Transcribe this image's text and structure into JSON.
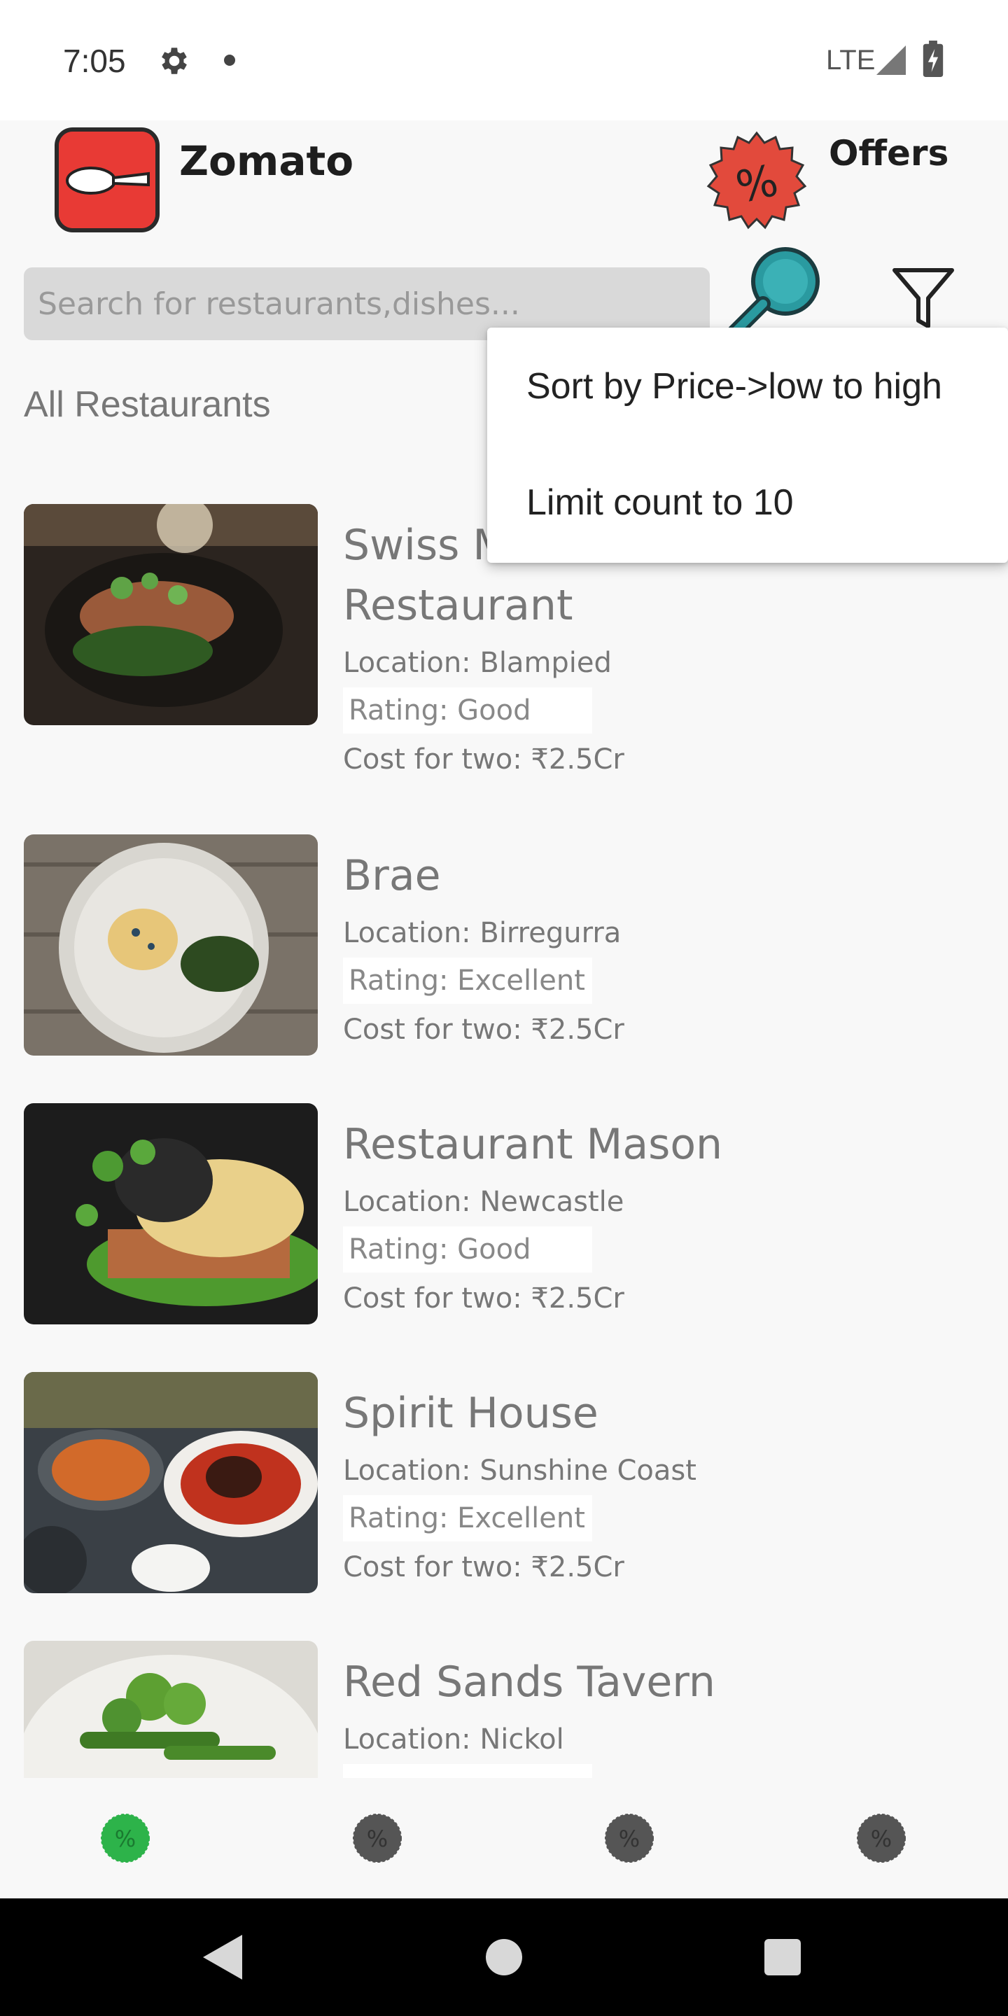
{
  "status_bar": {
    "time": "7:05",
    "network": "LTE",
    "icons": [
      "gear-icon",
      "notification-dot-icon",
      "signal-icon",
      "battery-charging-icon"
    ]
  },
  "header": {
    "app_name": "Zomato",
    "logo_icon": "spoon-logo-icon",
    "offers_label": "Offers",
    "offers_icon": "percent-badge-icon"
  },
  "search": {
    "placeholder": "Search for restaurants,dishes...",
    "value": "",
    "search_icon": "magnifier-icon",
    "filter_icon": "filter-icon"
  },
  "section_title": "All Restaurants",
  "menu": {
    "items": [
      {
        "label": "Sort by Price->low to high"
      },
      {
        "label": "Limit count to 10"
      }
    ]
  },
  "restaurants": [
    {
      "name": "Swiss M",
      "name_line2": "Restaurant",
      "location": "Location: Blampied",
      "rating": "Rating: Good",
      "cost": "Cost for two: ₹2.5Cr"
    },
    {
      "name": "Brae",
      "location": "Location: Birregurra",
      "rating": "Rating: Excellent",
      "cost": "Cost for two: ₹2.5Cr"
    },
    {
      "name": "Restaurant Mason",
      "location": "Location: Newcastle",
      "rating": "Rating: Good",
      "cost": "Cost for two: ₹2.5Cr"
    },
    {
      "name": "Spirit House",
      "location": "Location: Sunshine Coast",
      "rating": "Rating: Excellent",
      "cost": "Cost for two: ₹2.5Cr"
    },
    {
      "name": "Red Sands Tavern",
      "location": "Location: Nickol",
      "rating": "",
      "cost": ""
    }
  ],
  "bottom_nav": {
    "active_index": 0,
    "tab_icons": [
      "percent-badge-icon",
      "percent-badge-icon",
      "percent-badge-icon",
      "percent-badge-icon"
    ]
  },
  "colors": {
    "active_tab": "#2db34a",
    "inactive_tab": "#555555",
    "logo_red": "#e83a35",
    "search_teal": "#2a9aa0"
  }
}
